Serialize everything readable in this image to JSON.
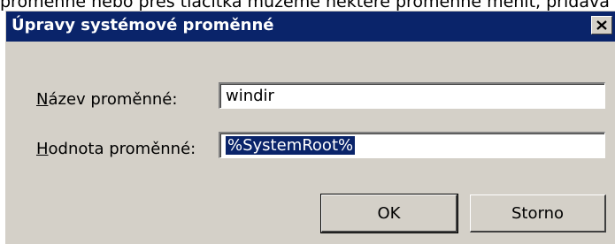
{
  "background": {
    "text": "proměnné nebo přes tlačítka můžeme některé proměnné měnit, přidáva"
  },
  "dialog": {
    "title": "Úpravy systémové proměnné",
    "close_icon": "close-x-icon",
    "name_label_u": "N",
    "name_label_rest": "ázev proměnné:",
    "name_value": "windir",
    "value_label_u": "H",
    "value_label_rest": "odnota proměnné:",
    "value_value": "%SystemRoot%",
    "ok_label": "OK",
    "cancel_label": "Storno"
  },
  "colors": {
    "titlebar": "#0a246a",
    "dialog_face": "#d4d0c8",
    "selection": "#0a246a"
  }
}
